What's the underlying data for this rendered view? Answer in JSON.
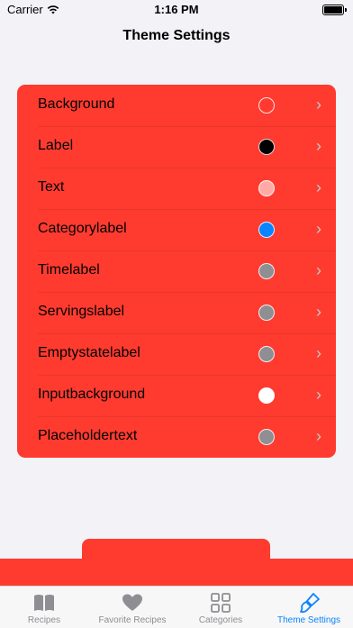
{
  "status_bar": {
    "carrier": "Carrier",
    "time": "1:16 PM"
  },
  "nav": {
    "title": "Theme Settings"
  },
  "settings": [
    {
      "label": "Background",
      "color": "#ff3b30"
    },
    {
      "label": "Label",
      "color": "#000000"
    },
    {
      "label": "Text",
      "color": "#ffaaa5"
    },
    {
      "label": "Categorylabel",
      "color": "#0a84ff"
    },
    {
      "label": "Timelabel",
      "color": "#8e8e93"
    },
    {
      "label": "Servingslabel",
      "color": "#8e8e93"
    },
    {
      "label": "Emptystatelabel",
      "color": "#8e8e93"
    },
    {
      "label": "Inputbackground",
      "color": "#ffffff"
    },
    {
      "label": "Placeholdertext",
      "color": "#8e8e93"
    }
  ],
  "tabs": [
    {
      "label": "Recipes",
      "icon": "book-icon",
      "active": false
    },
    {
      "label": "Favorite Recipes",
      "icon": "heart-icon",
      "active": false
    },
    {
      "label": "Categories",
      "icon": "grid-icon",
      "active": false
    },
    {
      "label": "Theme Settings",
      "icon": "paintbrush-icon",
      "active": true
    }
  ],
  "colors": {
    "accent": "#ff3b30",
    "tint": "#0a84ff",
    "inactive": "#8e8e93"
  }
}
